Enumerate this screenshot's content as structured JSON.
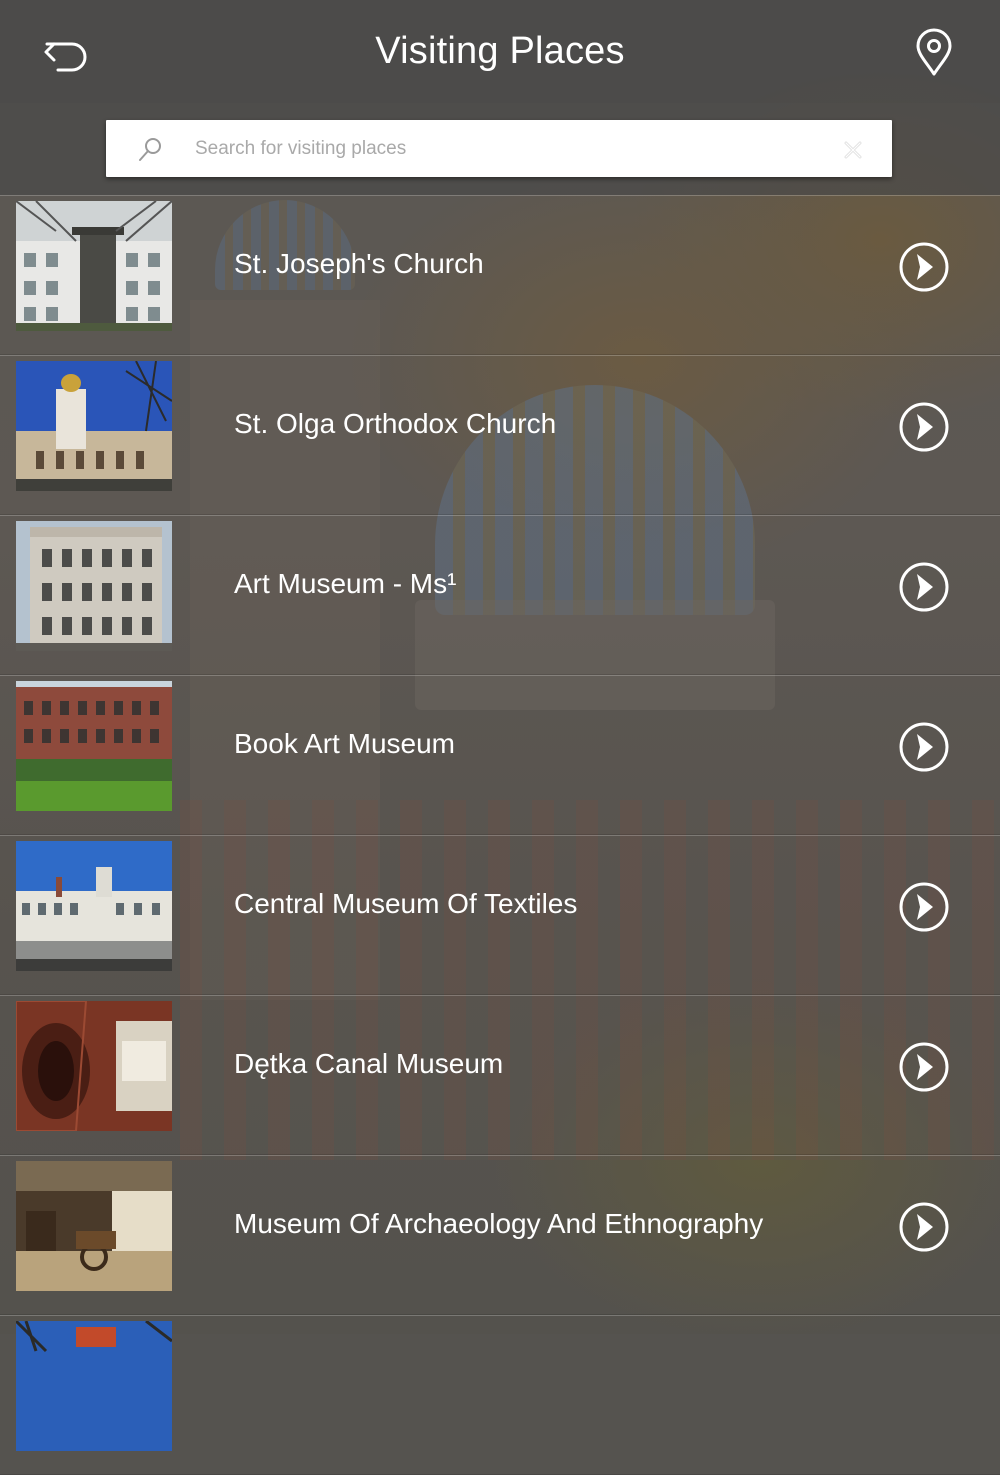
{
  "header": {
    "title": "Visiting Places",
    "back_icon": "back-arrow-icon",
    "map_icon": "map-pin-icon"
  },
  "search": {
    "placeholder": "Search for visiting places",
    "value": "",
    "search_icon": "search-icon",
    "clear_icon": "clear-icon"
  },
  "places": [
    {
      "name": "St. Joseph's Church"
    },
    {
      "name": "St. Olga Orthodox Church"
    },
    {
      "name": "Art Museum - Ms¹"
    },
    {
      "name": "Book Art Museum"
    },
    {
      "name": "Central Museum Of Textiles"
    },
    {
      "name": "Dętka Canal Museum"
    },
    {
      "name": "Museum Of Archaeology And Ethnography"
    },
    {
      "name": ""
    }
  ],
  "colors": {
    "bar_bg": "#464646",
    "text": "#ffffff",
    "placeholder": "#a9a9a9"
  }
}
